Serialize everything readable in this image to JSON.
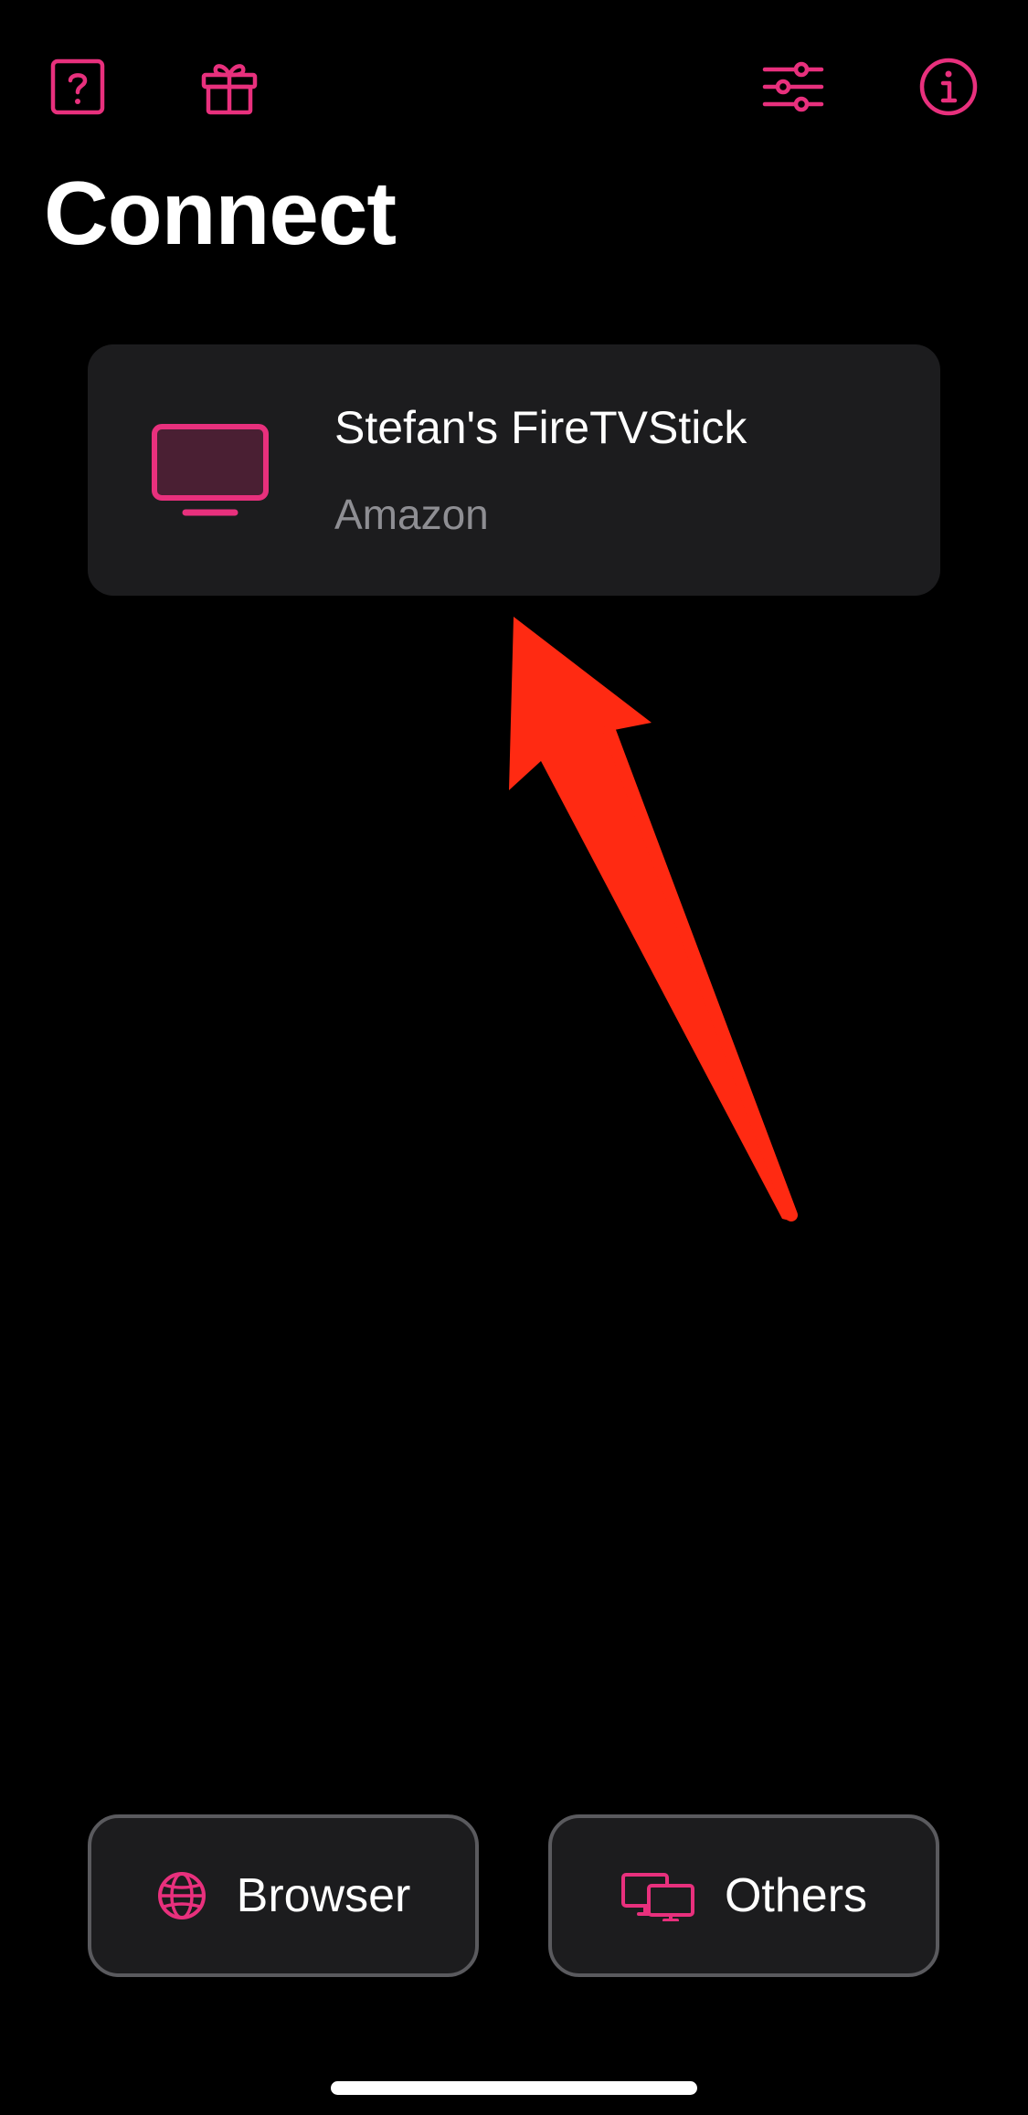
{
  "header": {
    "title": "Connect",
    "left_icons": [
      "help-icon",
      "gift-icon"
    ],
    "right_icons": [
      "settings-sliders-icon",
      "info-icon"
    ]
  },
  "devices": [
    {
      "name": "Stefan's FireTVStick",
      "brand": "Amazon",
      "icon": "tv-icon"
    }
  ],
  "bottom_buttons": {
    "browser": {
      "label": "Browser",
      "icon": "globe-icon"
    },
    "others": {
      "label": "Others",
      "icon": "multiple-screens-icon"
    }
  },
  "annotation": {
    "icon": "arrow-icon",
    "color": "#ff2a12"
  },
  "colors": {
    "accent": "#e8307d",
    "background": "#000000",
    "card": "#1c1c1e",
    "secondary_text": "#8e8e93",
    "button_border": "#5a5a5e"
  }
}
